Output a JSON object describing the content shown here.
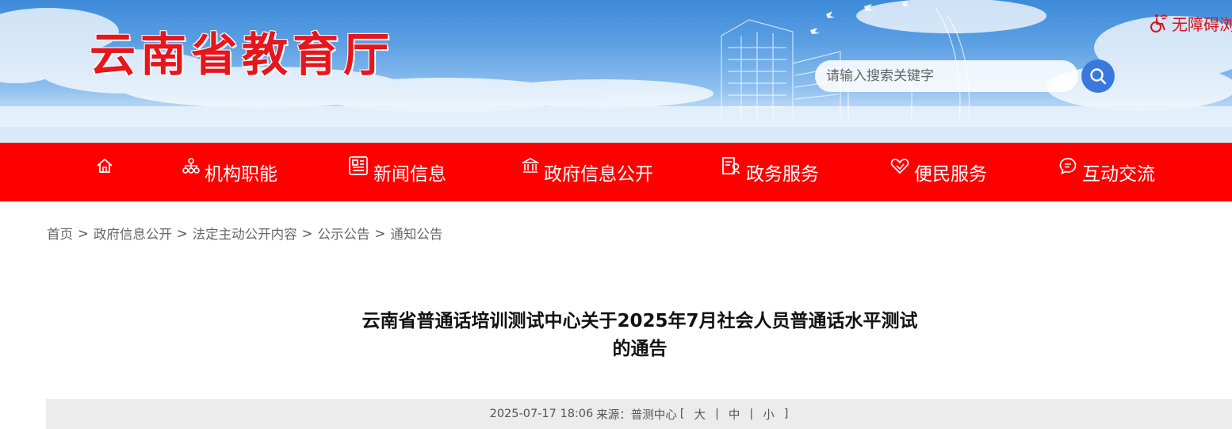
{
  "site": {
    "title": "云南省教育厅",
    "title_color": "#e5161c"
  },
  "accessibility": {
    "label": "无障碍浏览"
  },
  "search": {
    "placeholder": "请输入搜索关键字",
    "button_color": "#3a78dd"
  },
  "nav": {
    "background": "#ff0000",
    "items": [
      {
        "label": "",
        "icon": "home-icon"
      },
      {
        "label": "机构职能",
        "icon": "org-chart-icon"
      },
      {
        "label": "新闻信息",
        "icon": "newspaper-icon"
      },
      {
        "label": "政府信息公开",
        "icon": "government-building-icon"
      },
      {
        "label": "政务服务",
        "icon": "service-document-icon"
      },
      {
        "label": "便民服务",
        "icon": "heart-hand-icon"
      },
      {
        "label": "互动交流",
        "icon": "chat-bubble-icon"
      }
    ]
  },
  "breadcrumb": [
    "首页",
    "政府信息公开",
    "法定主动公开内容",
    "公示公告",
    "通知公告"
  ],
  "article": {
    "title_line1": "云南省普通话培训测试中心关于2025年7月社会人员普通话水平测试",
    "title_line2": "的通告",
    "datetime": "2025-07-17 18:06",
    "source_label": "来源：",
    "source": "普测中心",
    "font_sizes": {
      "open": "[",
      "large": "大",
      "medium": "中",
      "small": "小",
      "close": "]"
    }
  }
}
